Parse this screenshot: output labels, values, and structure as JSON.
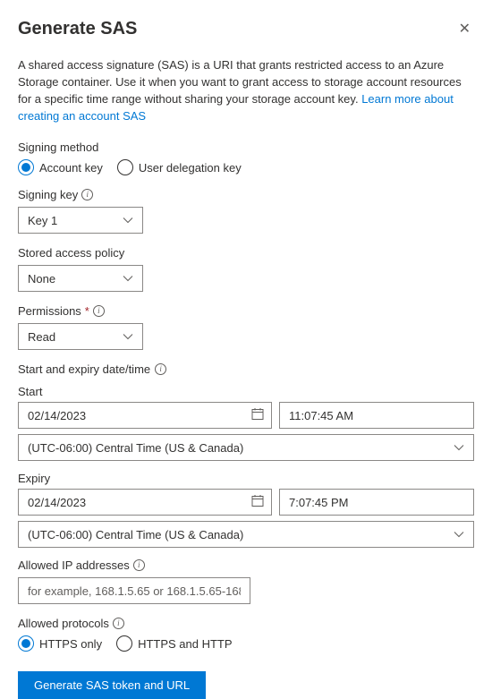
{
  "header": {
    "title": "Generate SAS"
  },
  "description": {
    "text": "A shared access signature (SAS) is a URI that grants restricted access to an Azure Storage container. Use it when you want to grant access to storage account resources for a specific time range without sharing your storage account key. ",
    "link_text": "Learn more about creating an account SAS"
  },
  "signing_method": {
    "label": "Signing method",
    "options": {
      "account_key": "Account key",
      "user_delegation": "User delegation key"
    }
  },
  "signing_key": {
    "label": "Signing key",
    "value": "Key 1"
  },
  "stored_policy": {
    "label": "Stored access policy",
    "value": "None"
  },
  "permissions": {
    "label": "Permissions",
    "value": "Read"
  },
  "datetime": {
    "section_label": "Start and expiry date/time",
    "start_label": "Start",
    "start_date": "02/14/2023",
    "start_time": "11:07:45 AM",
    "start_tz": "(UTC-06:00) Central Time (US & Canada)",
    "expiry_label": "Expiry",
    "expiry_date": "02/14/2023",
    "expiry_time": "7:07:45 PM",
    "expiry_tz": "(UTC-06:00) Central Time (US & Canada)"
  },
  "allowed_ip": {
    "label": "Allowed IP addresses",
    "placeholder": "for example, 168.1.5.65 or 168.1.5.65-168.1...."
  },
  "allowed_protocols": {
    "label": "Allowed protocols",
    "options": {
      "https_only": "HTTPS only",
      "https_and_http": "HTTPS and HTTP"
    }
  },
  "button": {
    "label": "Generate SAS token and URL"
  }
}
